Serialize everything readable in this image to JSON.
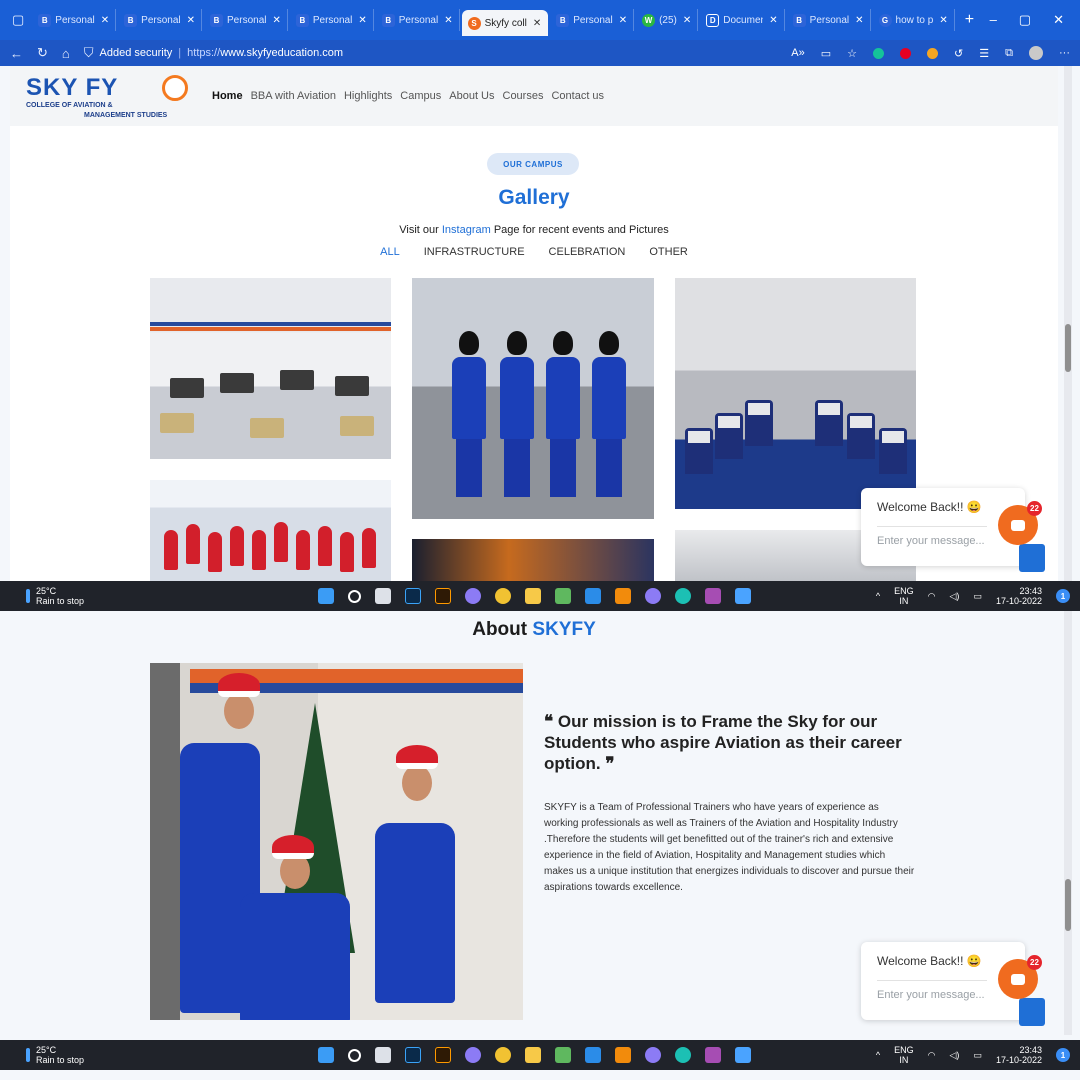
{
  "browser": {
    "tabs": [
      {
        "icon": "B",
        "label": "Personal",
        "active": false
      },
      {
        "icon": "B",
        "label": "Personal",
        "active": false
      },
      {
        "icon": "B",
        "label": "Personal",
        "active": false
      },
      {
        "icon": "B",
        "label": "Personal",
        "active": false
      },
      {
        "icon": "B",
        "label": "Personal",
        "active": false
      },
      {
        "icon": "S",
        "label": "Skyfy coll",
        "active": true
      },
      {
        "icon": "B",
        "label": "Personal",
        "active": false
      },
      {
        "icon": "W",
        "label": "(25)",
        "active": false
      },
      {
        "icon": "D",
        "label": "Documen",
        "active": false
      },
      {
        "icon": "B",
        "label": "Personal",
        "active": false
      },
      {
        "icon": "G",
        "label": "how to p",
        "active": false
      }
    ],
    "security_label": "Added security",
    "url_prefix": "https://",
    "url_host": "www.skyfyeducation.com"
  },
  "site": {
    "logo_main": "SKY FY",
    "logo_line1": "COLLEGE OF AVIATION &",
    "logo_line2": "MANAGEMENT STUDIES",
    "nav": [
      "Home",
      "BBA with Aviation",
      "Highlights",
      "Campus",
      "About Us",
      "Courses",
      "Contact us"
    ]
  },
  "gallery": {
    "pill": "OUR CAMPUS",
    "title": "Gallery",
    "visit_before": "Visit our",
    "visit_link": "Instagram",
    "visit_after": "Page for recent events and Pictures",
    "filters": [
      "ALL",
      "INFRASTRUCTURE",
      "CELEBRATION",
      "OTHER"
    ]
  },
  "chat": {
    "welcome": "Welcome Back!! 😀",
    "placeholder": "Enter your message...",
    "badge": "22"
  },
  "taskbar": {
    "temp": "25°C",
    "weather": "Rain to stop",
    "lang1": "ENG",
    "lang2": "IN",
    "time": "23:43",
    "date": "17-10-2022",
    "notif": "1"
  },
  "about": {
    "title_prefix": "About",
    "title_brand": "SKYFY",
    "quote": "❝ Our mission is to Frame the Sky for our Students who aspire Aviation as their career option. ❞",
    "body": "SKYFY is a Team of Professional Trainers who have years of experience as working professionals as well as Trainers of the Aviation and Hospitality Industry .Therefore the students will get benefitted out of the trainer's rich and extensive experience in the field of Aviation, Hospitality and Management studies which makes us a unique institution that energizes individuals to discover and pursue their aspirations towards excellence."
  },
  "colors": {
    "accent": "#1f6fd6",
    "brand_orange": "#f06b1f",
    "browser_blue": "#1a5fd6",
    "taskbar": "#20232a"
  }
}
